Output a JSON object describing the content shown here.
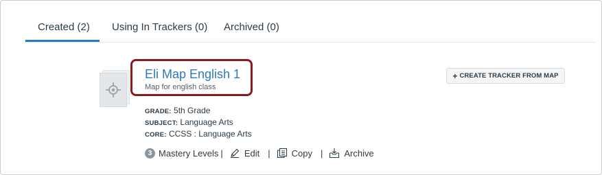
{
  "tabs": [
    {
      "label": "Created (2)",
      "active": true
    },
    {
      "label": "Using In Trackers (0)",
      "active": false
    },
    {
      "label": "Archived (0)",
      "active": false
    }
  ],
  "map": {
    "title": "Eli Map English 1",
    "description": "Map for english class",
    "grade_key": "GRADE:",
    "grade": "5th Grade",
    "subject_key": "SUBJECT:",
    "subject": "Language Arts",
    "core_key": "CORE:",
    "core": "CCSS : Language Arts",
    "mastery_count": "3",
    "mastery_label": "Mastery Levels",
    "sep": "|",
    "edit_label": "Edit",
    "copy_label": "Copy",
    "archive_label": "Archive"
  },
  "create_button": {
    "plus": "+",
    "label": "CREATE TRACKER FROM MAP"
  },
  "colors": {
    "accent": "#2b7abc",
    "highlight": "#8b1a1f"
  }
}
